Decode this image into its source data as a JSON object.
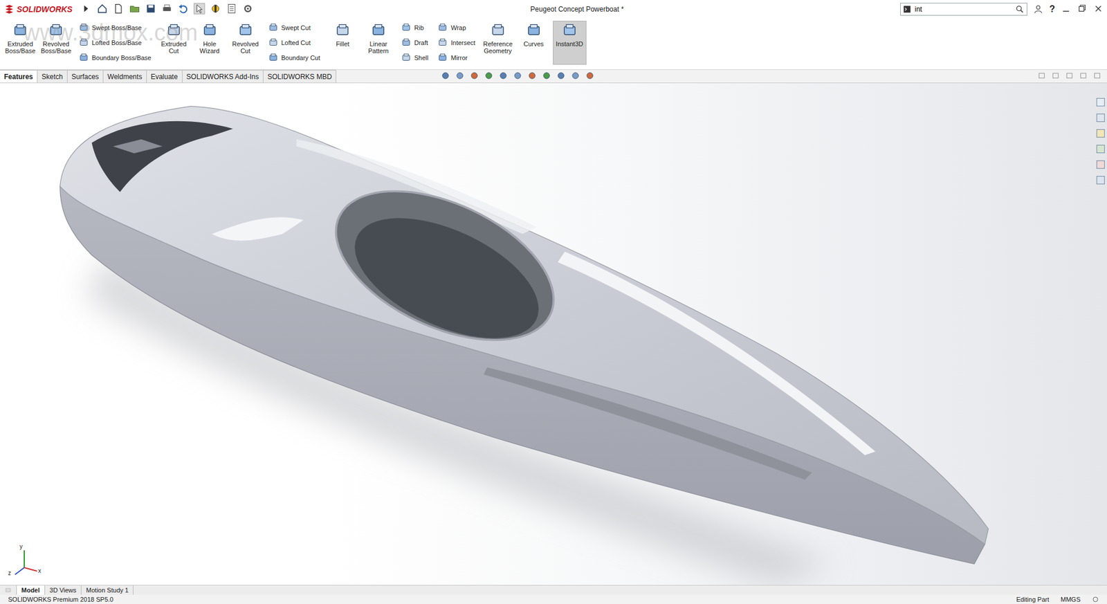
{
  "window": {
    "title": "Peugeot Concept Powerboat *"
  },
  "logo": "SOLIDWORKS",
  "watermark": "www.3dmox.com",
  "search": {
    "value": "int"
  },
  "help": "?",
  "ribbon": [
    {
      "kind": "large",
      "label": "Extruded Boss/Base",
      "selected": false
    },
    {
      "kind": "large",
      "label": "Revolved Boss/Base",
      "selected": false
    },
    {
      "kind": "stack",
      "items": [
        {
          "label": "Swept Boss/Base",
          "selected": false
        },
        {
          "label": "Lofted Boss/Base",
          "selected": false
        },
        {
          "label": "Boundary Boss/Base",
          "selected": false
        }
      ]
    },
    {
      "kind": "large",
      "label": "Extruded Cut",
      "selected": false
    },
    {
      "kind": "large",
      "label": "Hole Wizard",
      "selected": false
    },
    {
      "kind": "large",
      "label": "Revolved Cut",
      "selected": false
    },
    {
      "kind": "stack",
      "items": [
        {
          "label": "Swept Cut",
          "selected": false
        },
        {
          "label": "Lofted Cut",
          "selected": false
        },
        {
          "label": "Boundary Cut",
          "selected": false
        }
      ]
    },
    {
      "kind": "large",
      "label": "Fillet",
      "selected": false
    },
    {
      "kind": "large",
      "label": "Linear Pattern",
      "selected": false
    },
    {
      "kind": "stack",
      "items": [
        {
          "label": "Rib",
          "selected": false
        },
        {
          "label": "Draft",
          "selected": false
        },
        {
          "label": "Shell",
          "selected": false
        }
      ]
    },
    {
      "kind": "stack",
      "items": [
        {
          "label": "Wrap",
          "selected": false
        },
        {
          "label": "Intersect",
          "selected": false
        },
        {
          "label": "Mirror",
          "selected": false
        }
      ]
    },
    {
      "kind": "large",
      "label": "Reference Geometry",
      "selected": false
    },
    {
      "kind": "large",
      "label": "Curves",
      "selected": false
    },
    {
      "kind": "large",
      "label": "Instant3D",
      "selected": true
    }
  ],
  "command_tabs": [
    {
      "label": "Features",
      "selected": true
    },
    {
      "label": "Sketch",
      "selected": false
    },
    {
      "label": "Surfaces",
      "selected": false
    },
    {
      "label": "Weldments",
      "selected": false
    },
    {
      "label": "Evaluate",
      "selected": false
    },
    {
      "label": "SOLIDWORKS Add-Ins",
      "selected": false
    },
    {
      "label": "SOLIDWORKS MBD",
      "selected": false
    }
  ],
  "triad": {
    "x": "x",
    "y": "y",
    "z": "z"
  },
  "model_tabs": [
    {
      "label": "Model",
      "selected": true
    },
    {
      "label": "3D Views",
      "selected": false
    },
    {
      "label": "Motion Study 1",
      "selected": false
    }
  ],
  "status_bar": {
    "product": "SOLIDWORKS Premium 2018 SP5.0",
    "mode": "Editing Part",
    "units": "MMGS"
  }
}
